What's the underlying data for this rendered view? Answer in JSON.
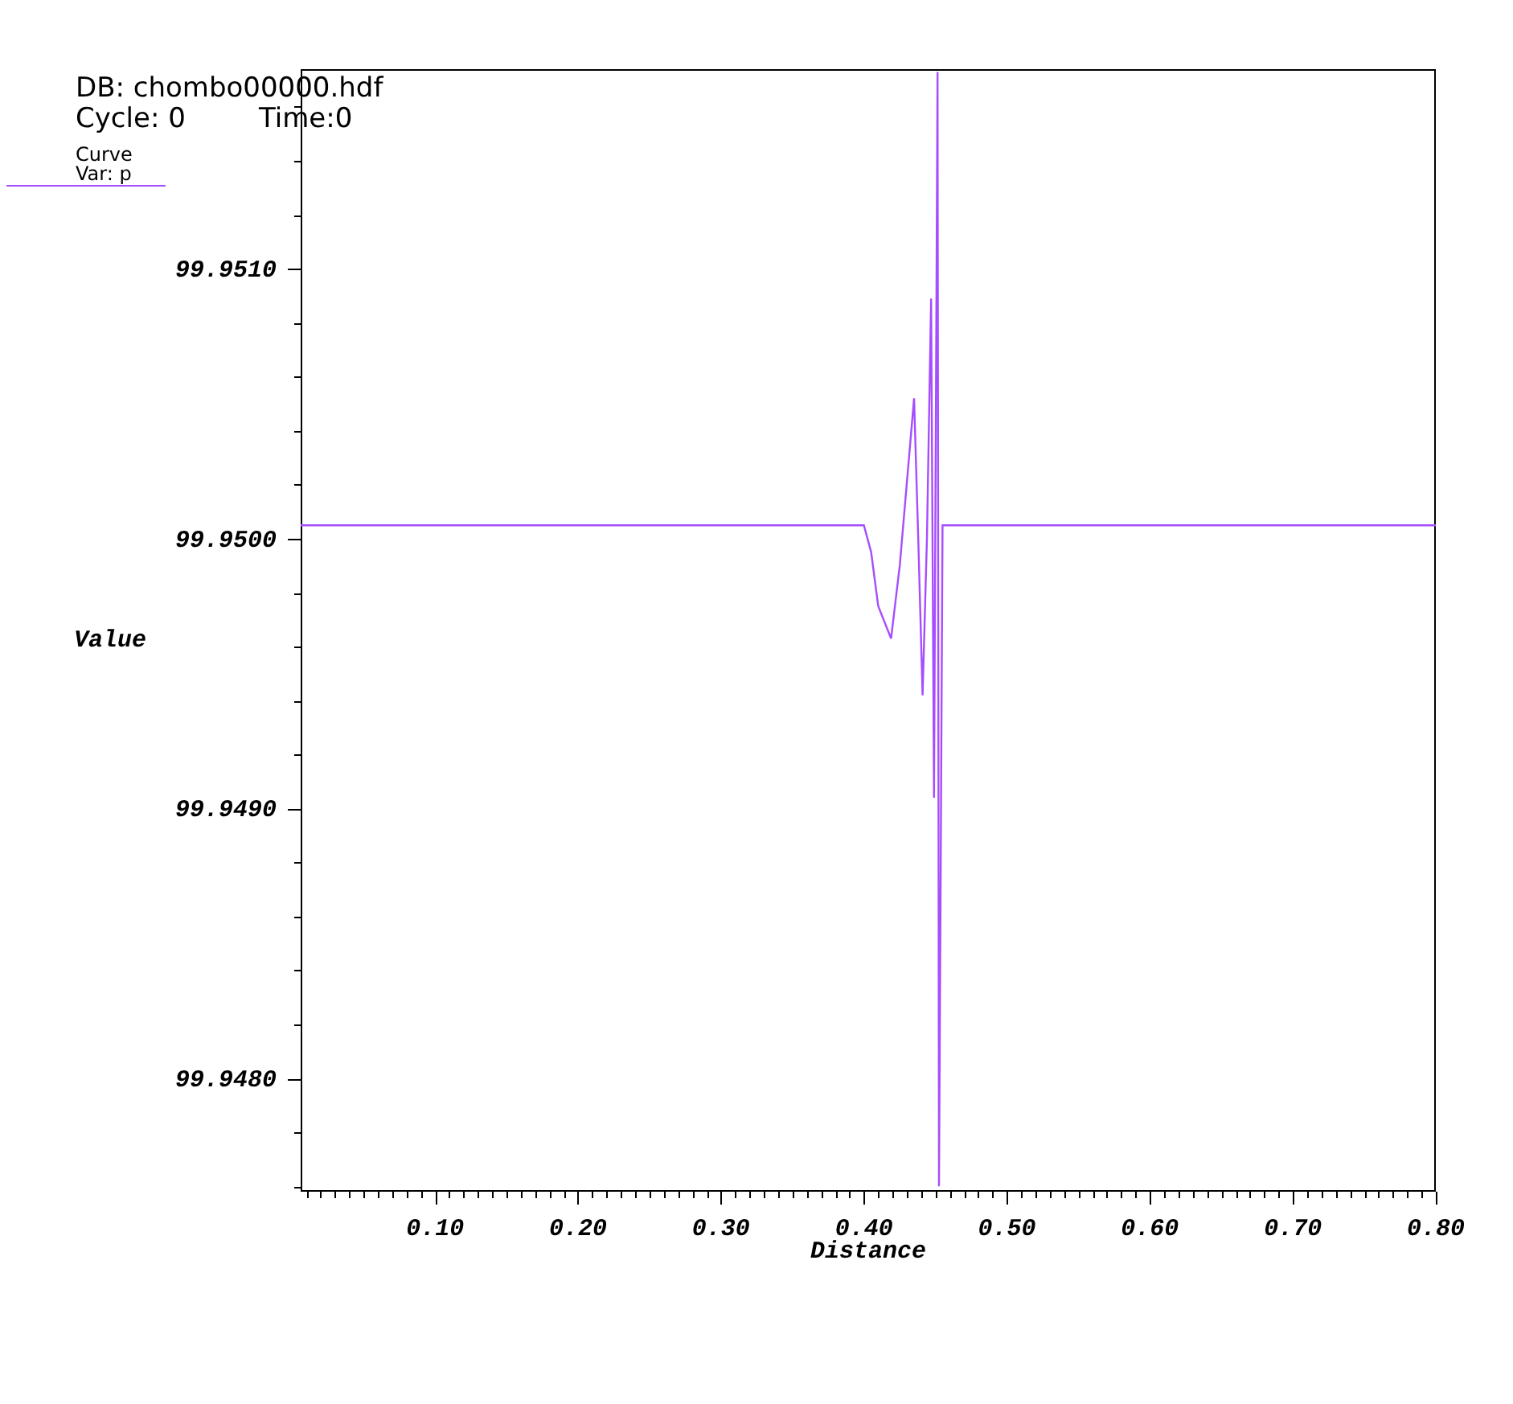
{
  "legend": {
    "database": "DB: chombo00000.hdf",
    "cycle": "Cycle: 0",
    "time": "Time:0",
    "plot_type": "Curve",
    "variable": "Var: p"
  },
  "chart_data": {
    "type": "line",
    "xlabel": "Distance",
    "ylabel": "Value",
    "x": [
      0.006,
      0.4,
      0.405,
      0.41,
      0.419,
      0.425,
      0.435,
      0.438,
      0.441,
      0.444,
      0.447,
      0.449,
      0.4515,
      0.4525,
      0.455,
      0.8
    ],
    "series": [
      {
        "color": "#a64dff",
        "values": [
          99.95005,
          99.95005,
          99.94995,
          99.94975,
          99.94963,
          99.9499,
          99.95052,
          99.95,
          99.94942,
          99.95,
          99.95089,
          99.94904,
          99.95173,
          99.9476,
          99.95005,
          99.95005
        ]
      }
    ],
    "xlim": [
      0.006,
      0.8
    ],
    "ylim": [
      99.94758,
      99.95174
    ],
    "xticks": [
      {
        "value": 0.1,
        "label": "0.10"
      },
      {
        "value": 0.2,
        "label": "0.20"
      },
      {
        "value": 0.3,
        "label": "0.30"
      },
      {
        "value": 0.4,
        "label": "0.40"
      },
      {
        "value": 0.5,
        "label": "0.50"
      },
      {
        "value": 0.6,
        "label": "0.60"
      },
      {
        "value": 0.7,
        "label": "0.70"
      },
      {
        "value": 0.8,
        "label": "0.80"
      }
    ],
    "yticks": [
      {
        "value": 99.948,
        "label": "99.9480"
      },
      {
        "value": 99.949,
        "label": "99.9490"
      },
      {
        "value": 99.95,
        "label": "99.9500"
      },
      {
        "value": 99.951,
        "label": "99.9510"
      }
    ]
  }
}
